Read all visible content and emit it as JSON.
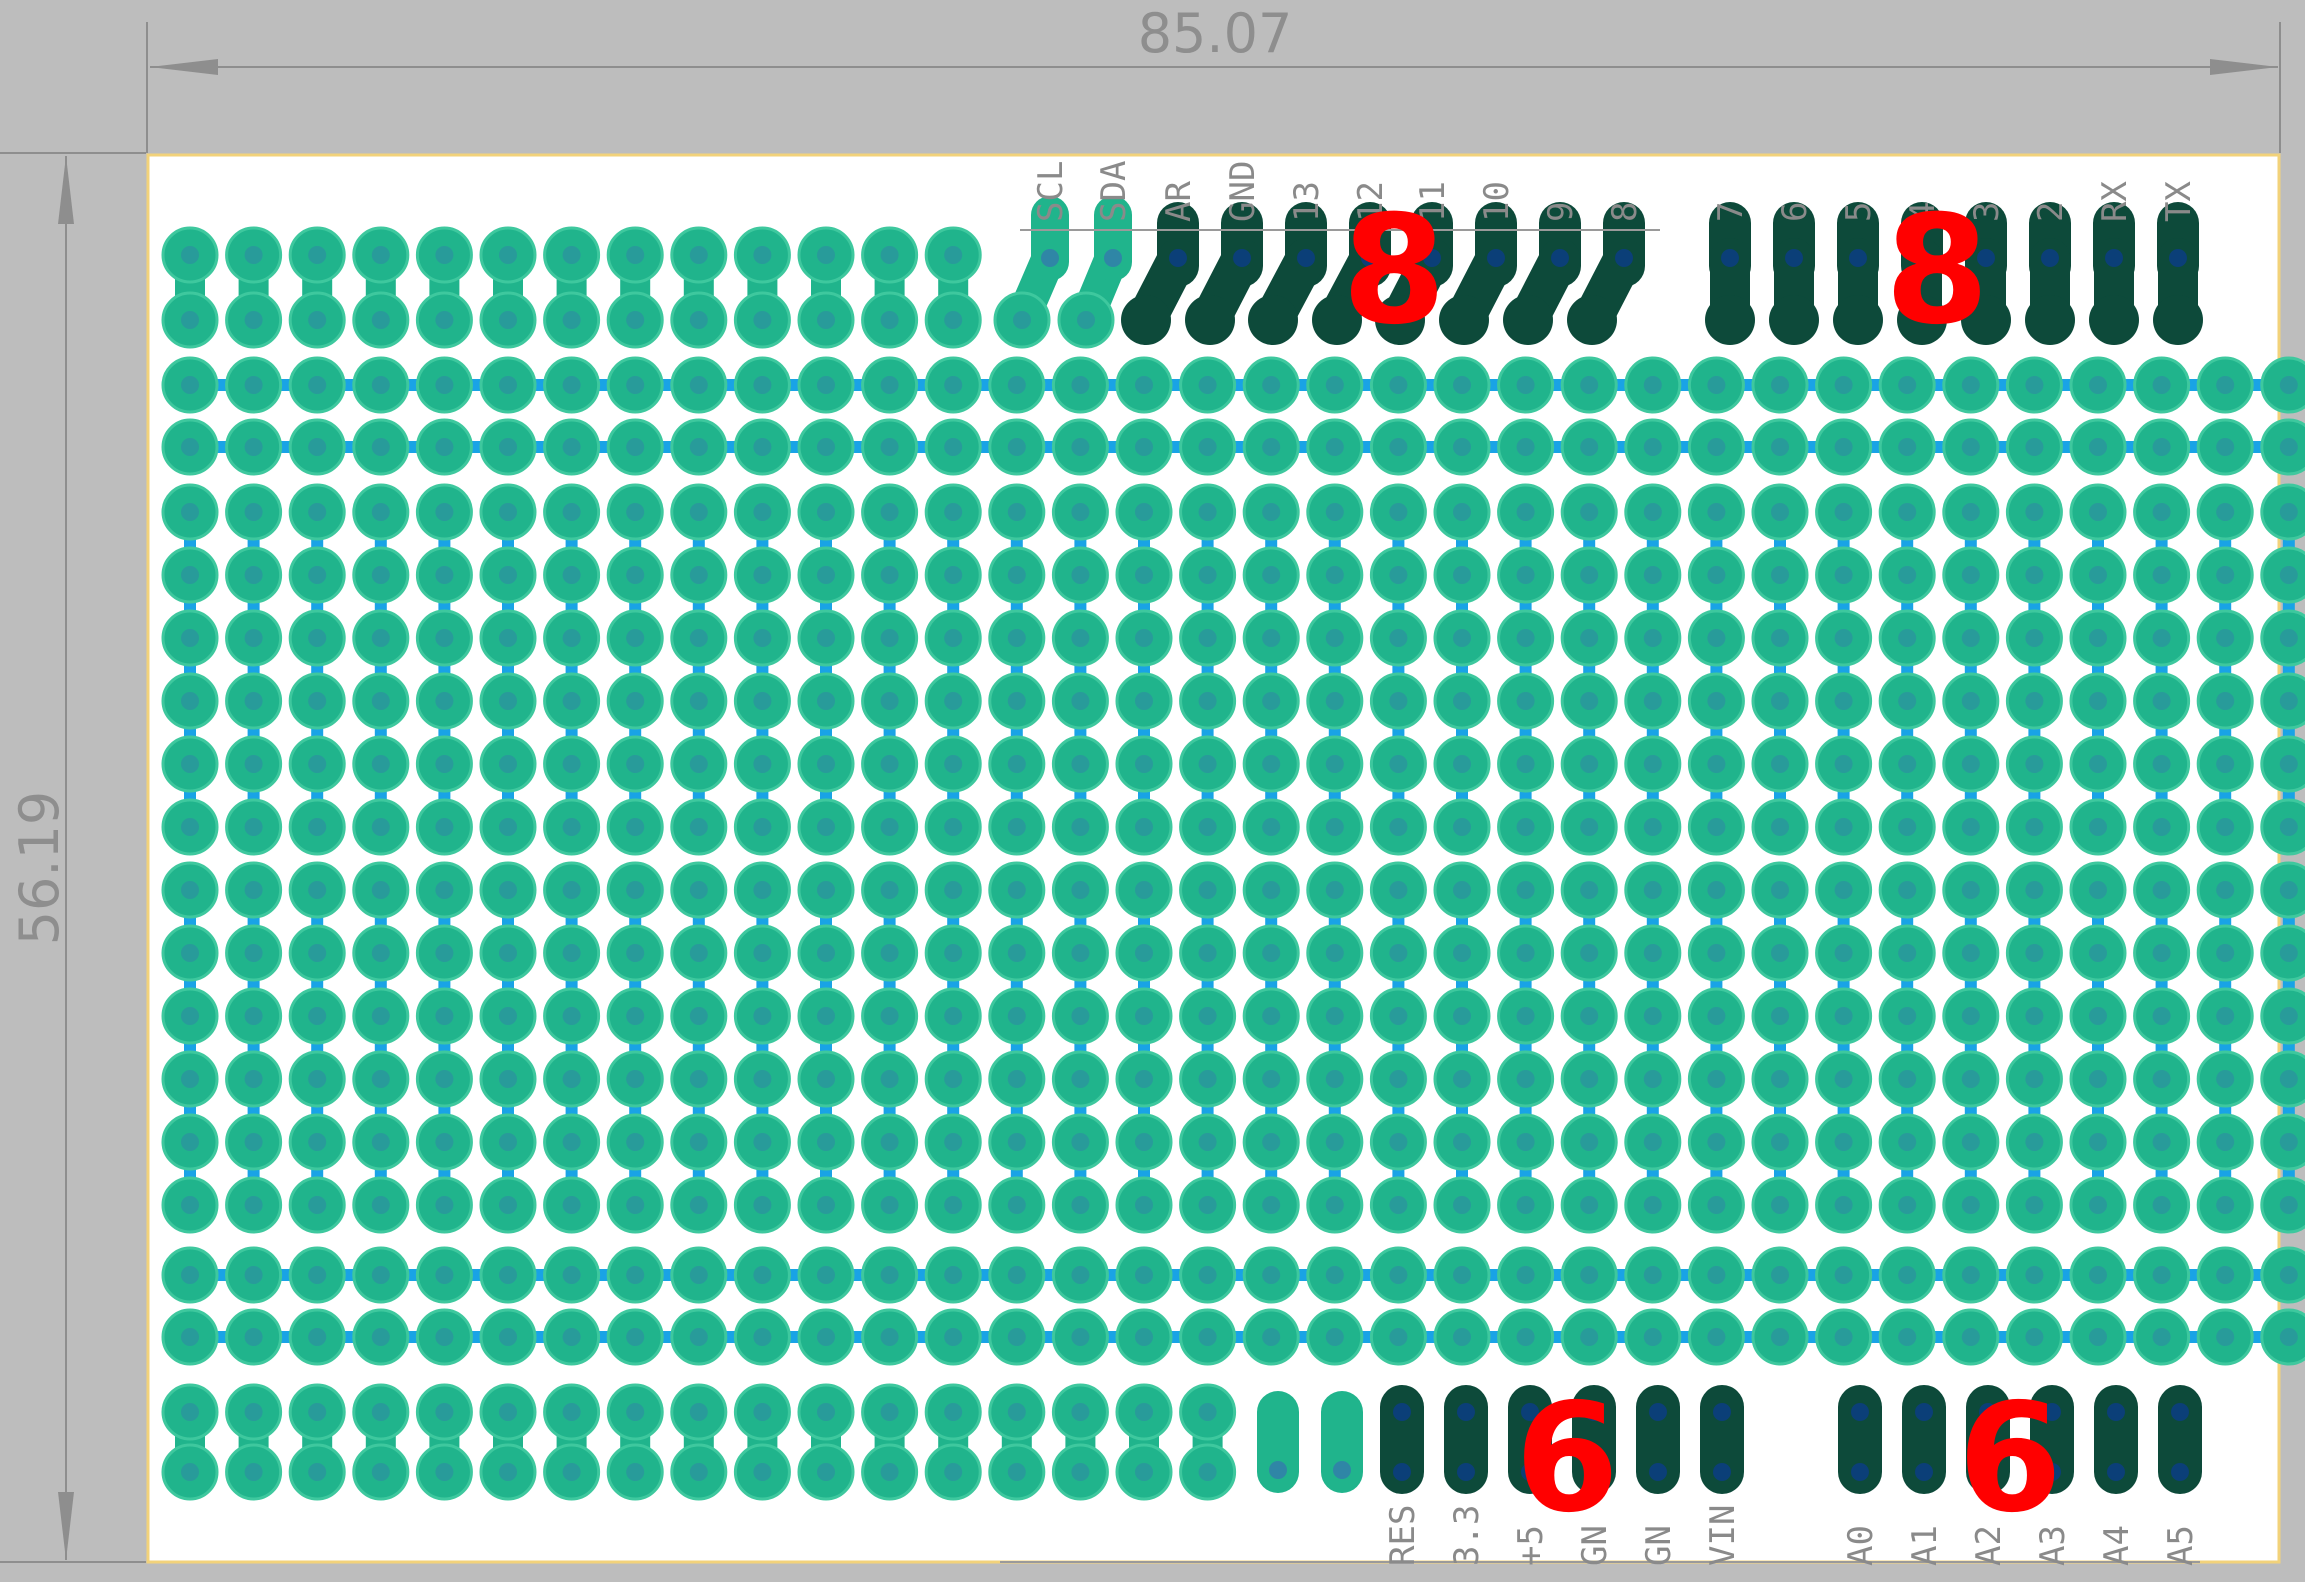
{
  "dimensions": {
    "width_label": "85.07",
    "height_label": "56.19"
  },
  "header_top": {
    "labels": [
      "SCL",
      "SDA",
      "AR",
      "GND",
      "13",
      "12",
      "11",
      "10",
      "9",
      "8",
      "7",
      "6",
      "5",
      "4",
      "3",
      "2",
      "RX",
      "TX"
    ],
    "count_left": "8",
    "count_right": "8"
  },
  "header_bottom": {
    "labels": [
      "RES",
      "3.3",
      "+5",
      "GN",
      "GN",
      "VIN",
      "A0",
      "A1",
      "A2",
      "A3",
      "A4",
      "A5"
    ],
    "count_left": "6",
    "count_right": "6"
  },
  "colors": {
    "background": "#bdbdbd",
    "board": "#ffffff",
    "board_outline": "#f2d27a",
    "pad": "#20b48c",
    "pad_ring": "#3ec89e",
    "header_pad": "#0d4a3a",
    "trace": "#19a3e6",
    "hole": "#2f86a6",
    "highlight": "#ff0000",
    "dimension": "#8e8e8e"
  }
}
